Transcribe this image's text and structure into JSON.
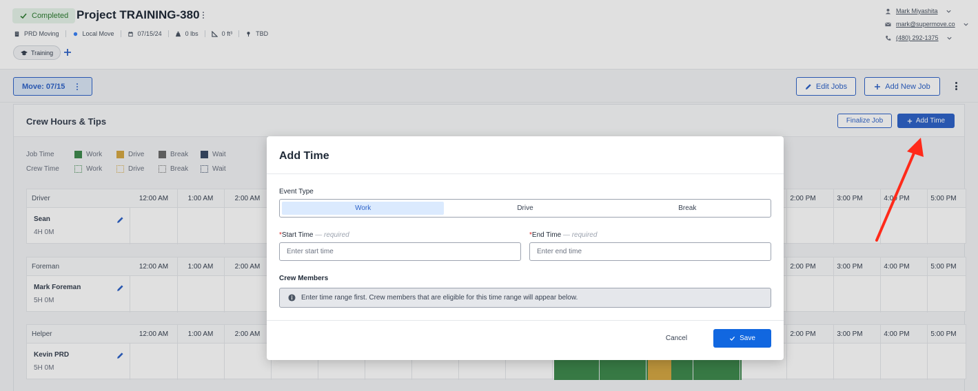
{
  "header": {
    "status": "Completed",
    "title": "Project TRAINING-380",
    "meta": {
      "organization": "PRD Moving",
      "move_type": "Local Move",
      "date": "07/15/24",
      "weight": "0 lbs",
      "volume": "0 ft³",
      "location": "TBD"
    },
    "tag": "Training",
    "contact": {
      "name": "Mark Miyashita",
      "email": "mark@supermove.co",
      "phone": "(480) 292-1375"
    }
  },
  "toolbar": {
    "move_chip": "Move: 07/15",
    "edit_jobs": "Edit Jobs",
    "add_new_job": "Add New Job"
  },
  "panel": {
    "title": "Crew Hours & Tips",
    "finalize_label": "Finalize Job",
    "add_time_label": "Add Time",
    "legend": {
      "job_time_label": "Job Time",
      "crew_time_label": "Crew Time",
      "items": [
        {
          "label": "Work",
          "color": "#3f8a4e"
        },
        {
          "label": "Drive",
          "color": "#d5a844"
        },
        {
          "label": "Break",
          "color": "#6b6b6b"
        },
        {
          "label": "Wait",
          "color": "#3a4a66"
        }
      ]
    },
    "time_labels_left": [
      "12:00 AM",
      "1:00 AM",
      "2:00 AM"
    ],
    "time_labels_right": [
      "2:00 PM",
      "3:00 PM",
      "4:00 PM",
      "5:00 PM"
    ],
    "crews": [
      {
        "role": "Driver",
        "name": "Sean",
        "hours": "4H 0M"
      },
      {
        "role": "Foreman",
        "name": "Mark Foreman",
        "hours": "5H 0M"
      },
      {
        "role": "Helper",
        "name": "Kevin PRD",
        "hours": "5H 0M"
      }
    ]
  },
  "modal": {
    "title": "Add Time",
    "event_type_label": "Event Type",
    "event_types": [
      "Work",
      "Drive",
      "Break"
    ],
    "selected_event_type": "Work",
    "start_label": "Start Time",
    "end_label": "End Time",
    "required_hint": "— required",
    "start_placeholder": "Enter start time",
    "end_placeholder": "Enter end time",
    "start_value": "",
    "end_value": "",
    "crew_members_label": "Crew Members",
    "info_text": "Enter time range first. Crew members that are eligible for this time range will appear below.",
    "cancel_label": "Cancel",
    "save_label": "Save"
  },
  "colors": {
    "accent": "#2f64c9",
    "primary_button": "#1167e0",
    "annotation_arrow": "#ff2a1a"
  }
}
